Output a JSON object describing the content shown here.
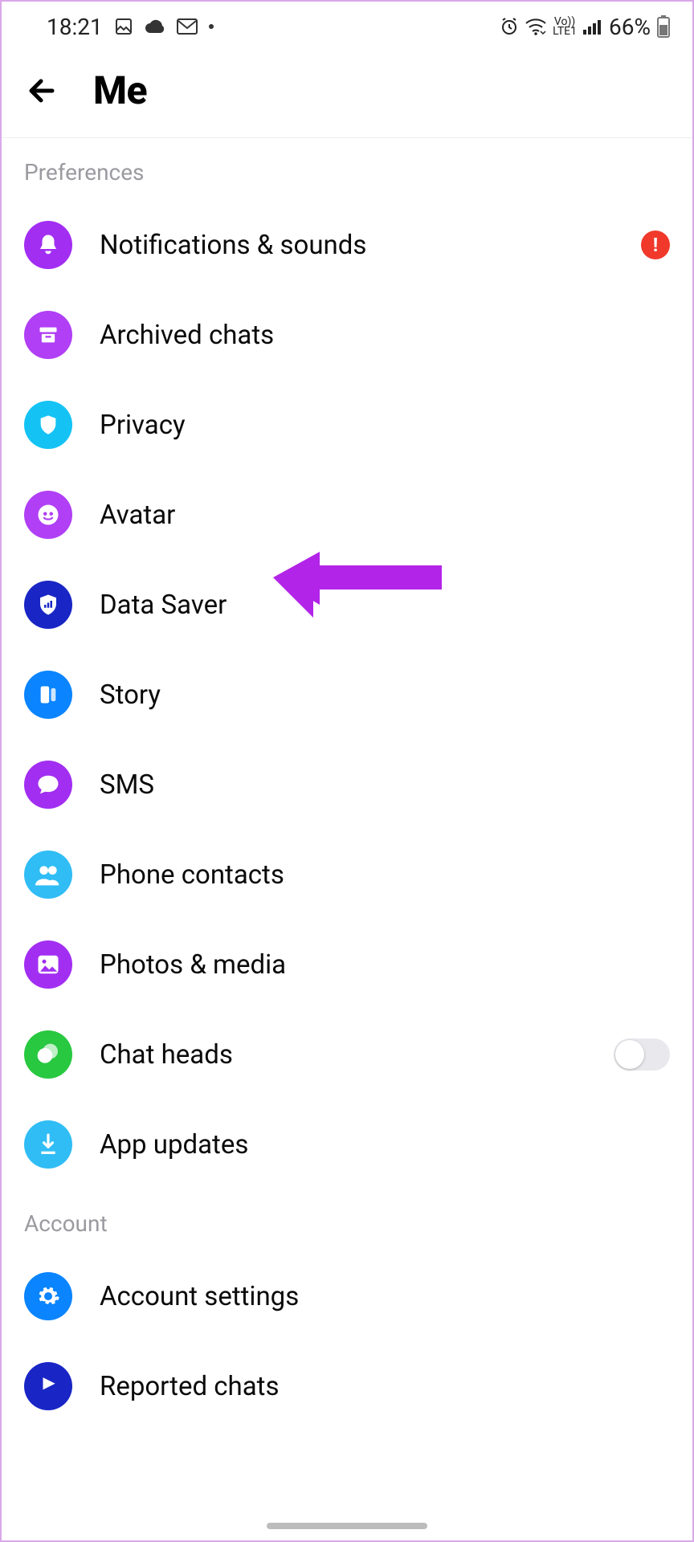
{
  "statusbar": {
    "time": "18:21",
    "battery_pct": "66%"
  },
  "header": {
    "title": "Me"
  },
  "sections": {
    "preferences_label": "Preferences",
    "account_label": "Account"
  },
  "preferences": {
    "notifications": "Notifications & sounds",
    "archived": "Archived chats",
    "privacy": "Privacy",
    "avatar": "Avatar",
    "data_saver": "Data Saver",
    "story": "Story",
    "sms": "SMS",
    "phone_contacts": "Phone contacts",
    "photos_media": "Photos & media",
    "chat_heads": "Chat heads",
    "app_updates": "App updates"
  },
  "account": {
    "account_settings": "Account settings",
    "reported_chats": "Reported chats"
  },
  "badges": {
    "notifications_alert": "!"
  },
  "annotation": {
    "arrow_color": "#b224e8"
  }
}
